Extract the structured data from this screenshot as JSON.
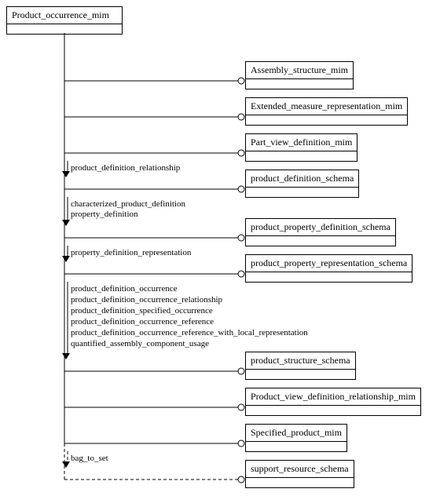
{
  "root": {
    "name": "Product_occurrence_mim"
  },
  "targets": [
    {
      "name": "Assembly_structure_mim"
    },
    {
      "name": "Extended_measure_representation_mim"
    },
    {
      "name": "Part_view_definition_mim"
    },
    {
      "name": "product_definition_schema"
    },
    {
      "name": "product_property_definition_schema"
    },
    {
      "name": "product_property_representation_schema"
    },
    {
      "name": "product_structure_schema"
    },
    {
      "name": "Product_view_definition_relationship_mim"
    },
    {
      "name": "Specified_product_mim"
    },
    {
      "name": "support_resource_schema"
    }
  ],
  "labels": {
    "r3": "product_definition_relationship",
    "r4a": "characterized_product_definition",
    "r4b": "property_definition",
    "r5": "property_definition_representation",
    "r6a": "product_definition_occurrence",
    "r6b": "product_definition_occurrence_relationship",
    "r6c": "product_definition_specified_occurrence",
    "r6d": "product_definition_occurrence_reference",
    "r6e": "product_definition_occurrence_reference_with_local_representation",
    "r6f": "quantified_assembly_component_usage",
    "r9": "bag_to_set"
  },
  "chart_data": {
    "type": "table",
    "title": "Schema dependency (USE FROM / REFERENCE FROM) diagram for Product_occurrence_mim",
    "root": "Product_occurrence_mim",
    "edges": [
      {
        "to": "Assembly_structure_mim",
        "items": [],
        "style": "solid"
      },
      {
        "to": "Extended_measure_representation_mim",
        "items": [],
        "style": "solid"
      },
      {
        "to": "Part_view_definition_mim",
        "items": [],
        "style": "solid"
      },
      {
        "to": "product_definition_schema",
        "items": [
          "product_definition_relationship"
        ],
        "style": "solid"
      },
      {
        "to": "product_property_definition_schema",
        "items": [
          "characterized_product_definition",
          "property_definition"
        ],
        "style": "solid"
      },
      {
        "to": "product_property_representation_schema",
        "items": [
          "property_definition_representation"
        ],
        "style": "solid"
      },
      {
        "to": "product_structure_schema",
        "items": [
          "product_definition_occurrence",
          "product_definition_occurrence_relationship",
          "product_definition_specified_occurrence",
          "product_definition_occurrence_reference",
          "product_definition_occurrence_reference_with_local_representation",
          "quantified_assembly_component_usage"
        ],
        "style": "solid"
      },
      {
        "to": "Product_view_definition_relationship_mim",
        "items": [],
        "style": "solid"
      },
      {
        "to": "Specified_product_mim",
        "items": [],
        "style": "solid"
      },
      {
        "to": "support_resource_schema",
        "items": [
          "bag_to_set"
        ],
        "style": "dashed"
      }
    ]
  }
}
